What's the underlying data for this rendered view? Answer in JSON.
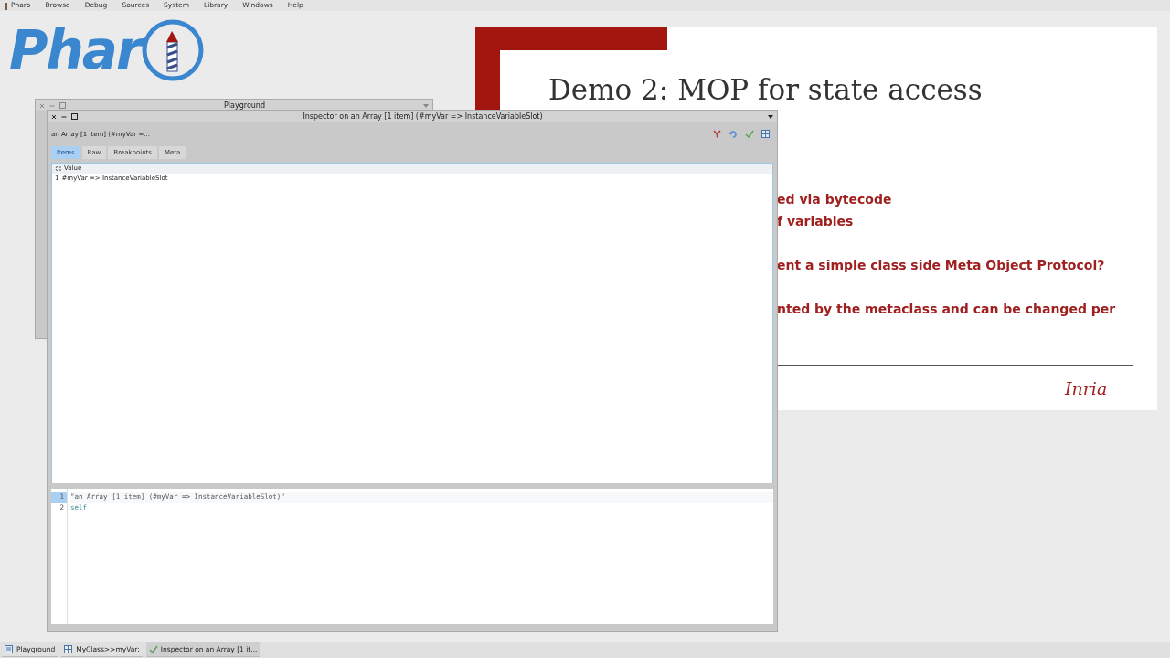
{
  "menu": [
    {
      "label": "Pharo",
      "kind": "app"
    },
    {
      "label": "Browse",
      "kind": "plain"
    },
    {
      "label": "Debug",
      "kind": "plain"
    },
    {
      "label": "Sources",
      "kind": "plain"
    },
    {
      "label": "System",
      "kind": "plain"
    },
    {
      "label": "Library",
      "kind": "plain"
    },
    {
      "label": "Windows",
      "kind": "plain"
    },
    {
      "label": "Help",
      "kind": "plain"
    }
  ],
  "logo": {
    "text": "Phar"
  },
  "slide": {
    "title": "Demo 2: MOP for state access",
    "paragraphs": [
      {
        "lines": [
          "ed via bytecode",
          "f variables"
        ]
      },
      {
        "lines": [
          "ent a simple class side Meta Object Protocol?"
        ]
      },
      {
        "lines": [
          "nted by the metaclass and can be changed per"
        ]
      }
    ],
    "footer_logo": "Inria"
  },
  "playground": {
    "title": "Playground"
  },
  "inspector": {
    "title": "Inspector on an Array [1 item] (#myVar => InstanceVariableSlot)",
    "subtitle": "an Array [1 item] (#myVar =...",
    "tabs": [
      {
        "label": "Items",
        "selected": true
      },
      {
        "label": "Raw",
        "selected": false
      },
      {
        "label": "Breakpoints",
        "selected": false
      },
      {
        "label": "Meta",
        "selected": false
      }
    ],
    "table": {
      "columns": [
        "Value"
      ],
      "rows": [
        {
          "index": "1",
          "value": "#myVar => InstanceVariableSlot"
        }
      ]
    },
    "editor": {
      "lines": [
        {
          "number": "1",
          "code": "\"an Array [1 item] (#myVar => InstanceVariableSlot)\"",
          "kind": "comment",
          "selected": true
        },
        {
          "number": "2",
          "code": "self",
          "kind": "keyword",
          "selected": false
        }
      ]
    }
  },
  "taskbar": [
    {
      "label": "Playground",
      "kind": "playground",
      "selected": false
    },
    {
      "label": "MyClass>>myVar:",
      "kind": "browser",
      "selected": false
    },
    {
      "label": "Inspector on an Array [1 it...",
      "kind": "inspector",
      "selected": true
    }
  ]
}
